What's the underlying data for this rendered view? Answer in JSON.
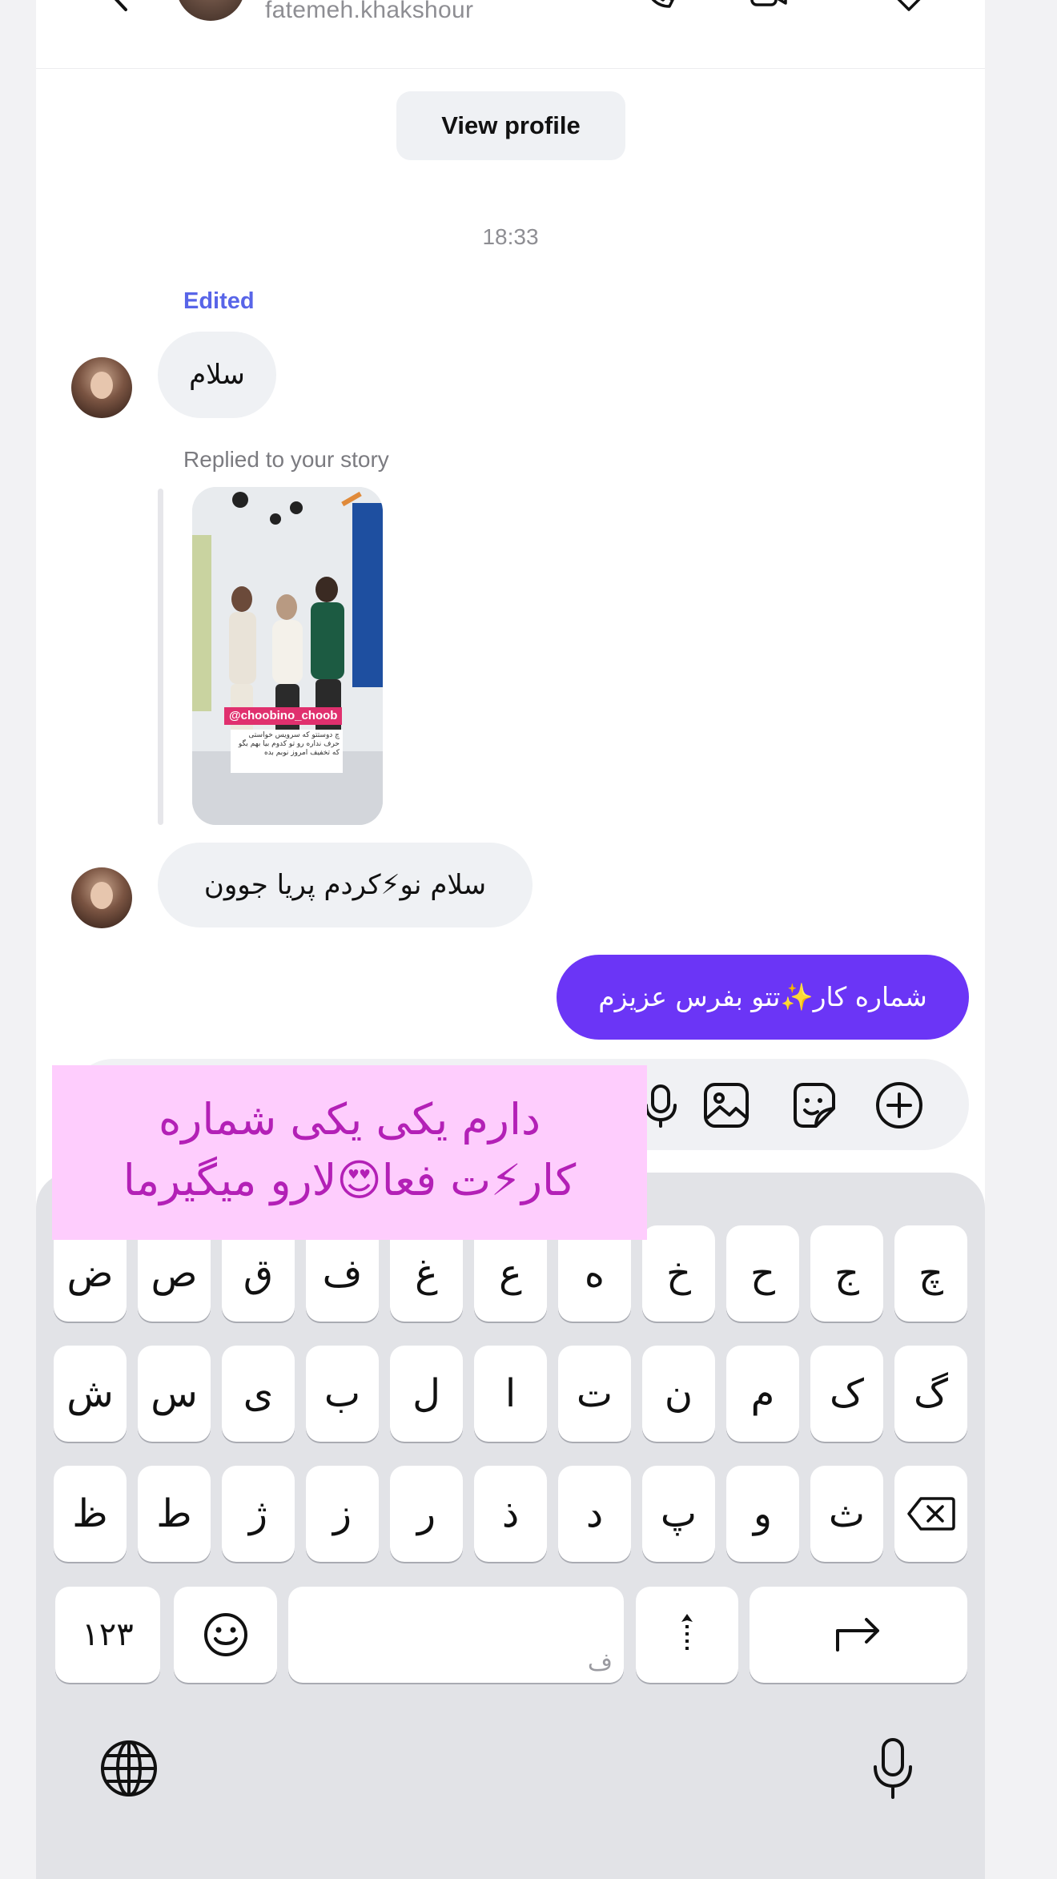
{
  "header": {
    "username": "fatemeh.khakshour",
    "back_icon": "chevron-left-icon",
    "call_icon": "phone-icon",
    "video_icon": "video-camera-icon",
    "tag_icon": "tag-icon"
  },
  "profile_button": "View profile",
  "timestamp": "18:33",
  "messages": [
    {
      "edited_label": "Edited",
      "text": "سلام"
    },
    {
      "reply_label": "Replied to your story",
      "story_tag": "@choobino_choob",
      "story_caption": "چ دوستتو که سرویس خواستی حرف نداره رو تو کدوم بیا بهم بگو که تخفیف امروز نوبم بده"
    },
    {
      "text": "سلام نو⚡کردم پریا جوون"
    }
  ],
  "outgoing_message": "شماره کار✨تتو بفرس عزیزم",
  "caption_overlay": {
    "line1": "دارم یکی یکی شماره",
    "line2": "کار⚡ت فعا😍لارو میگیرما"
  },
  "composer_icons": [
    "microphone-icon",
    "gallery-icon",
    "sticker-icon",
    "plus-circle-icon"
  ],
  "keyboard": {
    "row1": [
      "چ",
      "ج",
      "ح",
      "خ",
      "ه",
      "ع",
      "غ",
      "ف",
      "ق",
      "ص",
      "ض"
    ],
    "row2": [
      "گ",
      "ک",
      "م",
      "ن",
      "ت",
      "ا",
      "ل",
      "ب",
      "ی",
      "س",
      "ش"
    ],
    "row3": [
      "ث",
      "و",
      "پ",
      "د",
      "ذ",
      "ر",
      "ز",
      "ژ",
      "ط",
      "ظ"
    ],
    "numbers_key": "۱۲۳",
    "space_hint": "ف",
    "colors": {
      "accent": "#6b35f6",
      "edited": "#5865e8",
      "overlay_bg": "#fecdfd",
      "overlay_text": "#b320b6"
    }
  }
}
